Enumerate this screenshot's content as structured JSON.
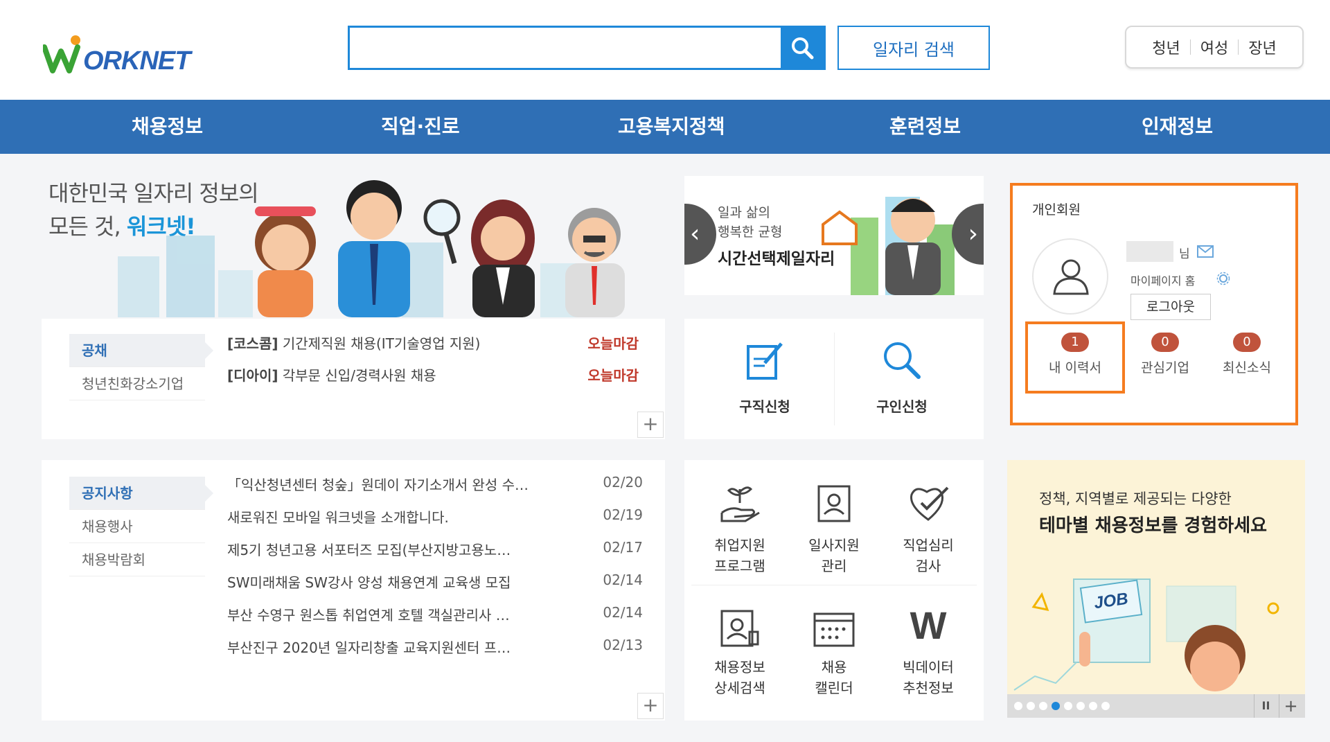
{
  "header": {
    "logo_text": "WORKNET",
    "search": {
      "placeholder": "",
      "value": ""
    },
    "job_search_label": "일자리 검색",
    "quick_links": [
      "청년",
      "여성",
      "장년"
    ]
  },
  "nav": {
    "items": [
      "채용정보",
      "직업·진로",
      "고용복지정책",
      "훈련정보",
      "인재정보"
    ]
  },
  "hero": {
    "line1": "대한민국 일자리 정보의",
    "line2_prefix": "모든 것, ",
    "line2_highlight": "워크넷!"
  },
  "recruit": {
    "tabs": [
      "공채",
      "청년친화강소기업"
    ],
    "rows": [
      {
        "company": "[코스콤]",
        "title": "기간제직원 채용(IT기술영업 지원)",
        "status": "오늘마감"
      },
      {
        "company": "[디아이]",
        "title": "각부문 신입/경력사원 채용",
        "status": "오늘마감"
      }
    ],
    "more": "+"
  },
  "slider": {
    "line1": "일과 삶의",
    "line2": "행복한 균형",
    "line3": "시간선택제일자리",
    "prev": "‹",
    "next": "›"
  },
  "apply": {
    "job_seek": "구직신청",
    "job_offer": "구인신청"
  },
  "member": {
    "title": "개인회원",
    "mypage": "마이페이지 홈",
    "logout": "로그아웃",
    "name_suffix": "님",
    "stats": [
      {
        "count": "1",
        "label": "내 이력서"
      },
      {
        "count": "0",
        "label": "관심기업"
      },
      {
        "count": "0",
        "label": "최신소식"
      }
    ]
  },
  "notice": {
    "tabs": [
      "공지사항",
      "채용행사",
      "채용박람회"
    ],
    "rows": [
      {
        "title": "「익산청년센터 청숲」원데이 자기소개서 완성 수…",
        "date": "02/20"
      },
      {
        "title": "새로워진 모바일 워크넷을 소개합니다.",
        "date": "02/19"
      },
      {
        "title": "제5기 청년고용 서포터즈 모집(부산지방고용노…",
        "date": "02/17"
      },
      {
        "title": "SW미래채움 SW강사 양성 채용연계 교육생 모집",
        "date": "02/14"
      },
      {
        "title": "부산 수영구 원스톱 취업연계 호텔 객실관리사 …",
        "date": "02/14"
      },
      {
        "title": "부산진구 2020년 일자리창출 교육지원센터 프…",
        "date": "02/13"
      }
    ],
    "more": "+"
  },
  "services": [
    {
      "line1": "취업지원",
      "line2": "프로그램",
      "icon": "plant-hand-icon"
    },
    {
      "line1": "일사지원",
      "line2": "관리",
      "icon": "profile-card-icon"
    },
    {
      "line1": "직업심리",
      "line2": "검사",
      "icon": "heart-check-icon"
    },
    {
      "line1": "채용정보",
      "line2": "상세검색",
      "icon": "document-person-icon"
    },
    {
      "line1": "채용",
      "line2": "캘린더",
      "icon": "calendar-icon"
    },
    {
      "line1": "빅데이터",
      "line2": "추천정보",
      "icon": "w-letter-icon"
    }
  ],
  "theme": {
    "line1": "정책, 지역별로 제공되는 다양한",
    "line2": "테마별 채용정보를 경험하세요",
    "job_card": "JOB",
    "pause": "II",
    "plus": "+"
  },
  "colors": {
    "nav": "#2f6fb5",
    "accent_blue": "#1e88d9",
    "highlight_orange": "#f57c1f",
    "badge": "#c0533c"
  }
}
